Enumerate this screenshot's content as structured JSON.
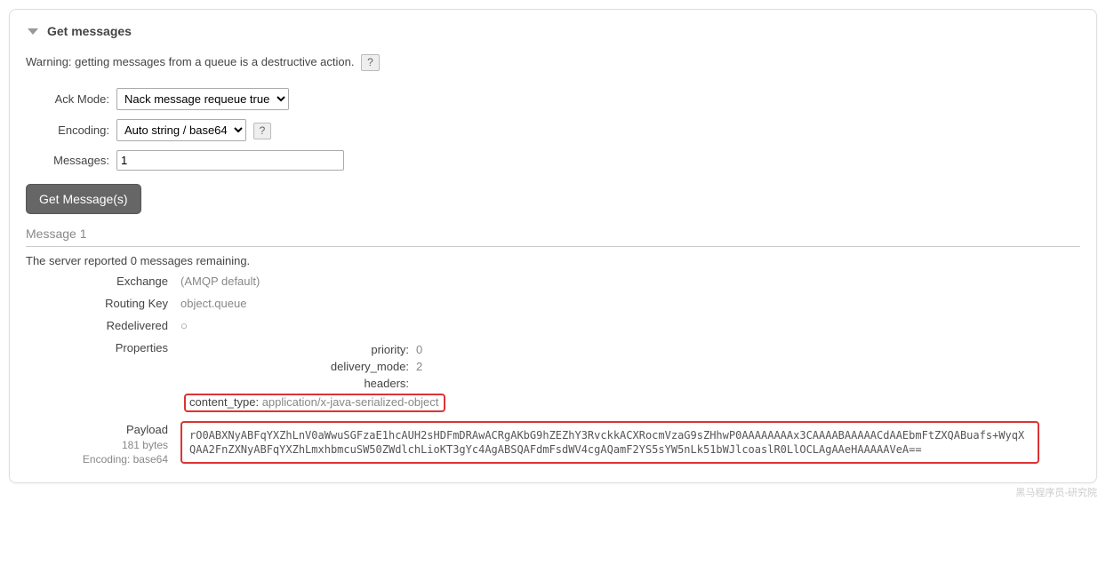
{
  "section": {
    "title": "Get messages"
  },
  "warning": "Warning: getting messages from a queue is a destructive action.",
  "help": "?",
  "form": {
    "ackModeLabel": "Ack Mode:",
    "ackModeValue": "Nack message requeue true",
    "encodingLabel": "Encoding:",
    "encodingValue": "Auto string / base64",
    "messagesLabel": "Messages:",
    "messagesValue": "1",
    "button": "Get Message(s)"
  },
  "message": {
    "header": "Message 1",
    "remaining": "The server reported 0 messages remaining.",
    "exchangeLabel": "Exchange",
    "exchangeValue": "(AMQP default)",
    "routingKeyLabel": "Routing Key",
    "routingKeyValue": "object.queue",
    "redeliveredLabel": "Redelivered",
    "redeliveredValue": "○",
    "propertiesLabel": "Properties",
    "props": {
      "priorityKey": "priority:",
      "priorityValue": "0",
      "deliveryModeKey": "delivery_mode:",
      "deliveryModeValue": "2",
      "headersKey": "headers:",
      "headersValue": "",
      "contentTypeKey": "content_type:",
      "contentTypeValue": "application/x-java-serialized-object"
    },
    "payloadLabel": "Payload",
    "payloadBytes": "181 bytes",
    "payloadEncoding": "Encoding: base64",
    "payloadValue": "rO0ABXNyABFqYXZhLnV0aWwuSGFzaE1hcAUH2sHDFmDRAwACRgAKbG9hZEZhY3RvckkACXRocmVzaG9sZHhwP0AAAAAAAAx3CAAAABAAAAACdAAEbmFtZXQABuafs+WyqXQAA2FnZXNyABFqYXZhLmxhbmcuSW50ZWdlchLioKT3gYc4AgABSQAFdmFsdWV4cgAQamF2YS5sYW5nLk51bWJlcoaslR0LlOCLAgAAeHAAAAAVeA=="
  },
  "watermark": "黑马程序员-研究院"
}
